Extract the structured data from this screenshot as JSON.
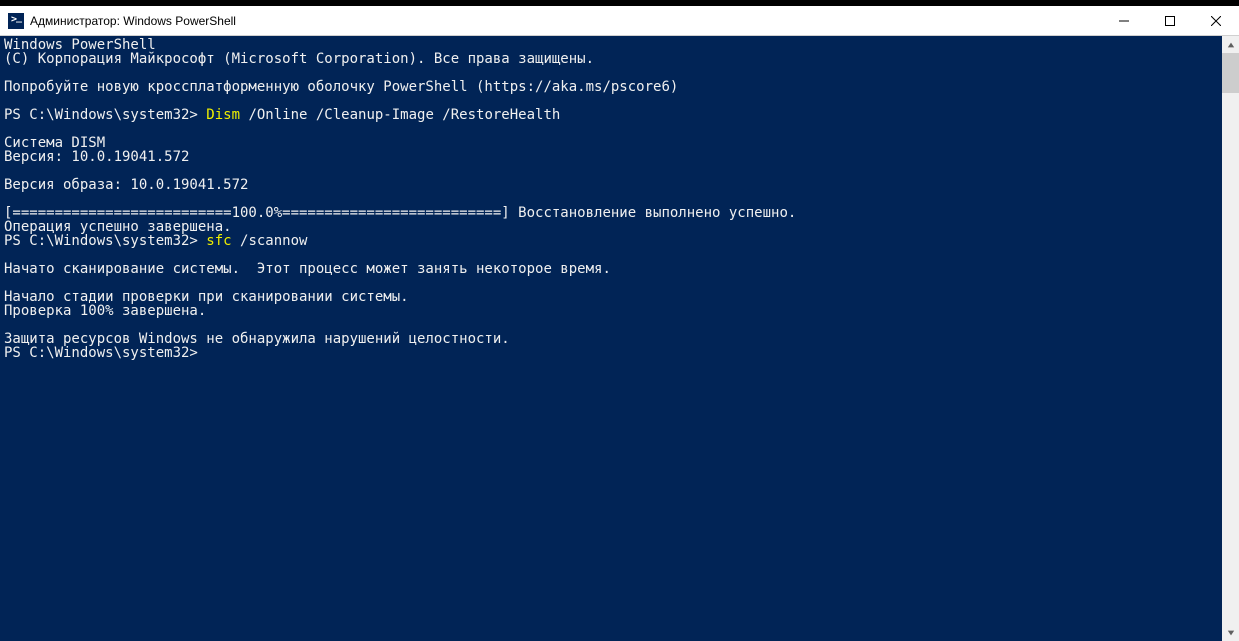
{
  "window": {
    "title": "Администратор: Windows PowerShell"
  },
  "terminal": {
    "lines": [
      {
        "segments": [
          {
            "text": "Windows PowerShell",
            "cls": "c-white"
          }
        ]
      },
      {
        "segments": [
          {
            "text": "(C) Корпорация Майкрософт (Microsoft Corporation). Все права защищены.",
            "cls": "c-white"
          }
        ]
      },
      {
        "segments": [
          {
            "text": "",
            "cls": "c-white"
          }
        ]
      },
      {
        "segments": [
          {
            "text": "Попробуйте новую кроссплатформенную оболочку PowerShell (https://aka.ms/pscore6)",
            "cls": "c-white"
          }
        ]
      },
      {
        "segments": [
          {
            "text": "",
            "cls": "c-white"
          }
        ]
      },
      {
        "segments": [
          {
            "text": "PS C:\\Windows\\system32> ",
            "cls": "c-white"
          },
          {
            "text": "Dism",
            "cls": "c-yellow"
          },
          {
            "text": " /Online /Cleanup-Image /RestoreHealth",
            "cls": "c-white"
          }
        ]
      },
      {
        "segments": [
          {
            "text": "",
            "cls": "c-white"
          }
        ]
      },
      {
        "segments": [
          {
            "text": "Cистема DISM",
            "cls": "c-white"
          }
        ]
      },
      {
        "segments": [
          {
            "text": "Версия: 10.0.19041.572",
            "cls": "c-white"
          }
        ]
      },
      {
        "segments": [
          {
            "text": "",
            "cls": "c-white"
          }
        ]
      },
      {
        "segments": [
          {
            "text": "Версия образа: 10.0.19041.572",
            "cls": "c-white"
          }
        ]
      },
      {
        "segments": [
          {
            "text": "",
            "cls": "c-white"
          }
        ]
      },
      {
        "segments": [
          {
            "text": "[==========================100.0%==========================] Восстановление выполнено успешно.",
            "cls": "c-white"
          }
        ]
      },
      {
        "segments": [
          {
            "text": "Операция успешно завершена.",
            "cls": "c-white"
          }
        ]
      },
      {
        "segments": [
          {
            "text": "PS C:\\Windows\\system32> ",
            "cls": "c-white"
          },
          {
            "text": "sfc",
            "cls": "c-yellow"
          },
          {
            "text": " /scannow",
            "cls": "c-white"
          }
        ]
      },
      {
        "segments": [
          {
            "text": "",
            "cls": "c-white"
          }
        ]
      },
      {
        "segments": [
          {
            "text": "Начато сканирование системы.  Этот процесс может занять некоторое время.",
            "cls": "c-white"
          }
        ]
      },
      {
        "segments": [
          {
            "text": "",
            "cls": "c-white"
          }
        ]
      },
      {
        "segments": [
          {
            "text": "Начало стадии проверки при сканировании системы.",
            "cls": "c-white"
          }
        ]
      },
      {
        "segments": [
          {
            "text": "Проверка 100% завершена.",
            "cls": "c-white"
          }
        ]
      },
      {
        "segments": [
          {
            "text": "",
            "cls": "c-white"
          }
        ]
      },
      {
        "segments": [
          {
            "text": "Защита ресурсов Windows не обнаружила нарушений целостности.",
            "cls": "c-white"
          }
        ]
      },
      {
        "segments": [
          {
            "text": "PS C:\\Windows\\system32>",
            "cls": "c-white"
          }
        ]
      }
    ]
  }
}
